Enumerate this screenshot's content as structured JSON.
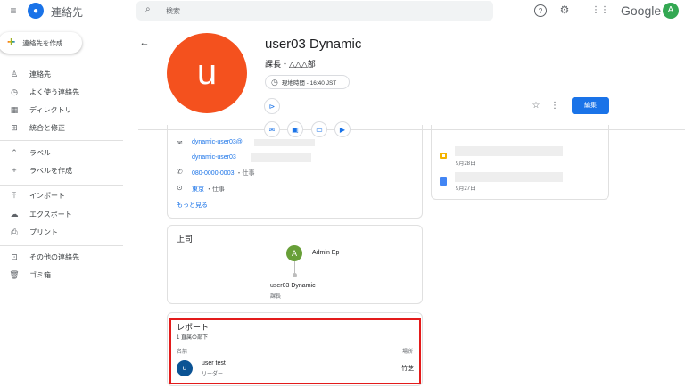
{
  "header": {
    "app_title": "連絡先",
    "search_placeholder": "検索",
    "google_text": "Google",
    "account_initial": "A"
  },
  "sidebar": {
    "create_label": "連絡先を作成",
    "items": [
      {
        "label": "連絡先",
        "icon": "person-icon"
      },
      {
        "label": "よく使う連絡先",
        "icon": "history-icon"
      },
      {
        "label": "ディレクトリ",
        "icon": "domain-icon"
      },
      {
        "label": "統合と修正",
        "icon": "merge-icon"
      },
      {
        "label": "ラベル",
        "icon": "chevron-up-icon"
      },
      {
        "label": "ラベルを作成",
        "icon": "plus-icon"
      },
      {
        "label": "インポート",
        "icon": "upload-icon"
      },
      {
        "label": "エクスポート",
        "icon": "cloud-download-icon"
      },
      {
        "label": "プリント",
        "icon": "print-icon"
      },
      {
        "label": "その他の連絡先",
        "icon": "archive-icon"
      },
      {
        "label": "ゴミ箱",
        "icon": "trash-icon"
      }
    ]
  },
  "contact": {
    "initial": "u",
    "name": "user03 Dynamic",
    "subtitle": "課長・△△△部",
    "local_time": "現地時間 - 16:40 JST",
    "edit_label": "編集",
    "avatar_color": "#f4511e"
  },
  "details": {
    "email1": "dynamic-user03@",
    "email2": "dynamic-user03",
    "phone": "080-0000-0003",
    "phone_type": "・仕事",
    "address": "東京",
    "address_type": "・仕事",
    "more_label": "もっと見る"
  },
  "manager": {
    "title": "上司",
    "manager_initial": "A",
    "manager_name": "Admin Ep",
    "self_name": "user03 Dynamic",
    "self_title": "課長"
  },
  "reports": {
    "title": "レポート",
    "count": "1 直属の部下",
    "col_name": "名前",
    "col_location": "場所",
    "rows": [
      {
        "initial": "u",
        "name": "user test",
        "title": "リーダー",
        "location": "竹芝"
      }
    ]
  },
  "activity": [
    {
      "date": "9月28日",
      "icon": "slides-icon"
    },
    {
      "date": "9月27日",
      "icon": "docs-icon"
    }
  ]
}
